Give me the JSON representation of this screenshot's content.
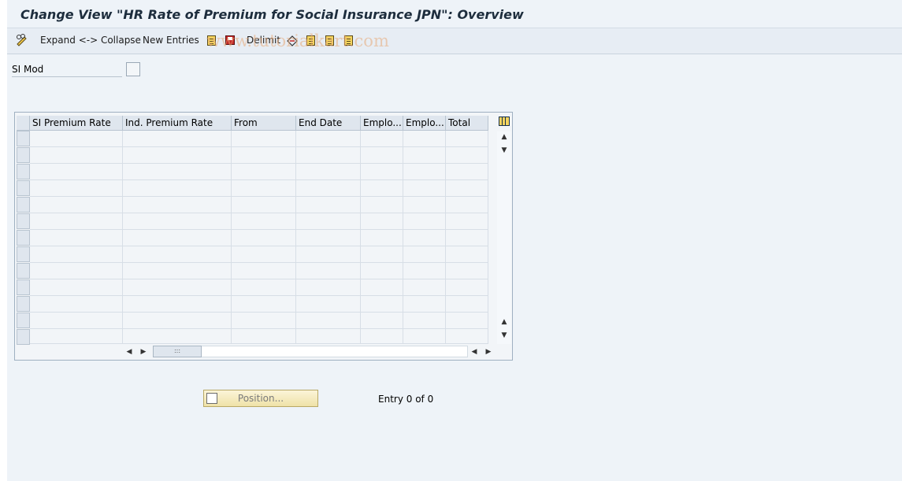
{
  "window": {
    "title": "Change View \"HR Rate of Premium for Social Insurance JPN\": Overview"
  },
  "toolbar": {
    "expand_collapse_label": "Expand <-> Collapse",
    "new_entries_label": "New Entries",
    "delimit_label": "Delimit"
  },
  "watermark": "www.tutorialkart.com",
  "form": {
    "si_mod_label": "SI Mod"
  },
  "table": {
    "columns": [
      "SI Premium Rate",
      "Ind. Premium Rate",
      "From",
      "End Date",
      "Emplo...",
      "Emplo...",
      "Total"
    ],
    "visible_rows": 13
  },
  "footer": {
    "position_button_label": "Position...",
    "entry_count": "Entry 0 of 0"
  },
  "icons": {
    "toolbar": [
      "pencil-glasses-icon",
      "copy-icon",
      "save-icon",
      "delimit-icon",
      "select-all-icon",
      "select-block-icon",
      "deselect-icon"
    ],
    "table": [
      "column-config-icon",
      "scroll-up-icon",
      "scroll-down-icon",
      "scroll-left-icon",
      "scroll-right-icon"
    ]
  },
  "colors": {
    "background": "#eef3f8",
    "title_text": "#1d2d3d",
    "button_bg": "#efe2a8"
  }
}
